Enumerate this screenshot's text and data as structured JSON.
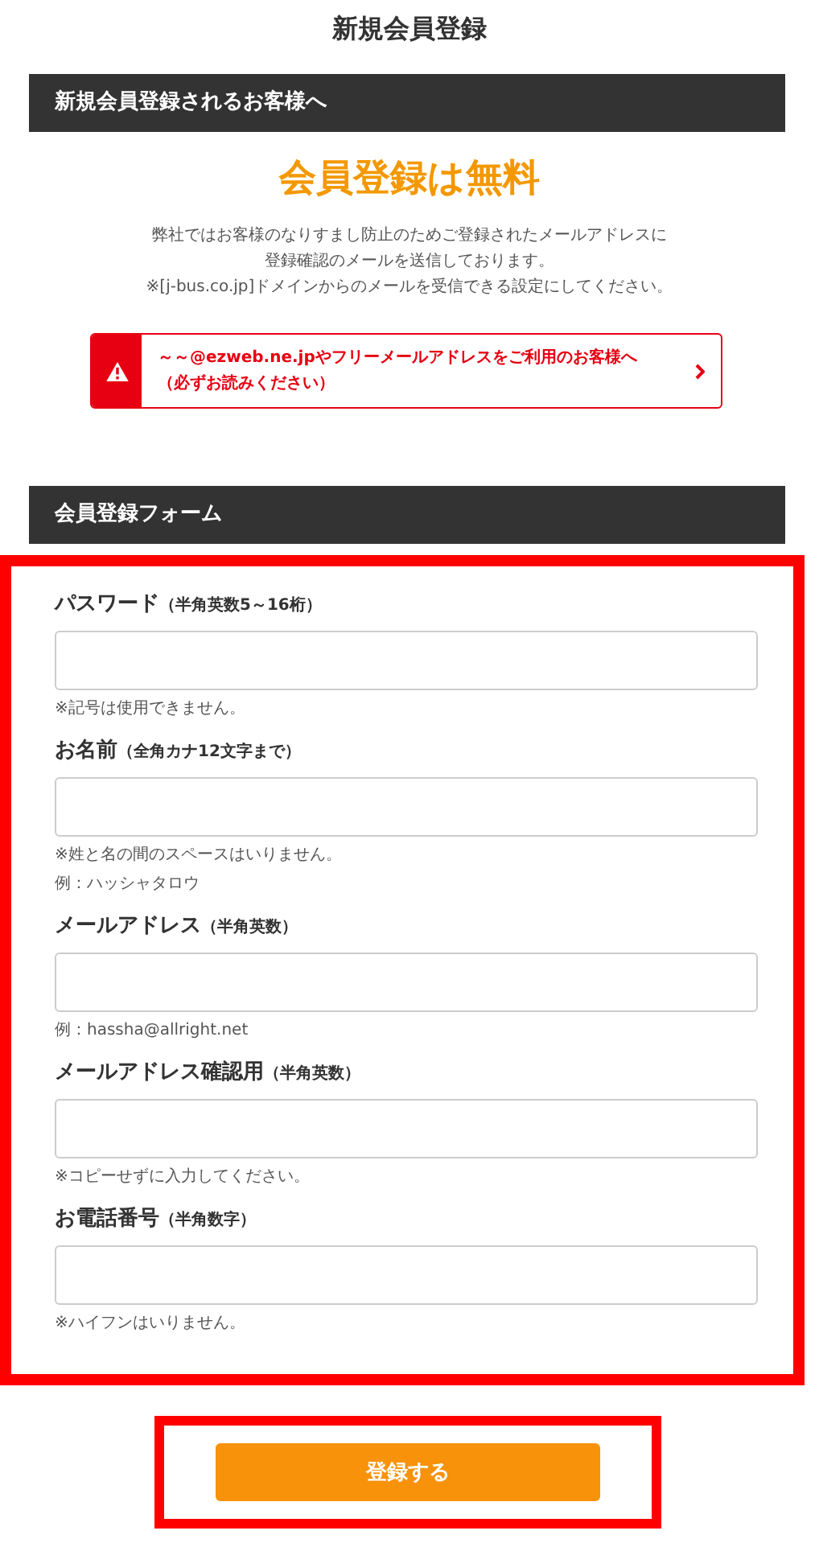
{
  "page_title": "新規会員登録",
  "intro": {
    "heading": "新規会員登録されるお客様へ",
    "headline": "会員登録は無料",
    "lines": [
      "弊社ではお客様のなりすまし防止のためご登録されたメールアドレスに",
      "登録確認のメールを送信しております。",
      "※[j-bus.co.jp]ドメインからのメールを受信できる設定にしてください。"
    ],
    "notice": {
      "lines": [
        "～～@ezweb.ne.jpやフリーメールアドレスをご利用のお客様へ",
        "（必ずお読みください）"
      ]
    }
  },
  "form": {
    "heading": "会員登録フォーム",
    "fields": [
      {
        "label": "パスワード",
        "hint": "（半角英数5～16桁）",
        "notes": [
          "※記号は使用できません。"
        ]
      },
      {
        "label": "お名前",
        "hint": "（全角カナ12文字まで）",
        "notes": [
          "※姓と名の間のスペースはいりません。",
          "例：ハッシャタロウ"
        ]
      },
      {
        "label": "メールアドレス",
        "hint": "（半角英数）",
        "notes": [
          "例：hassha@allright.net"
        ]
      },
      {
        "label": "メールアドレス確認用",
        "hint": "（半角英数）",
        "notes": [
          "※コピーせずに入力してください。"
        ]
      },
      {
        "label": "お電話番号",
        "hint": "（半角数字）",
        "notes": [
          "※ハイフンはいりません。"
        ]
      }
    ]
  },
  "submit": "登録する"
}
